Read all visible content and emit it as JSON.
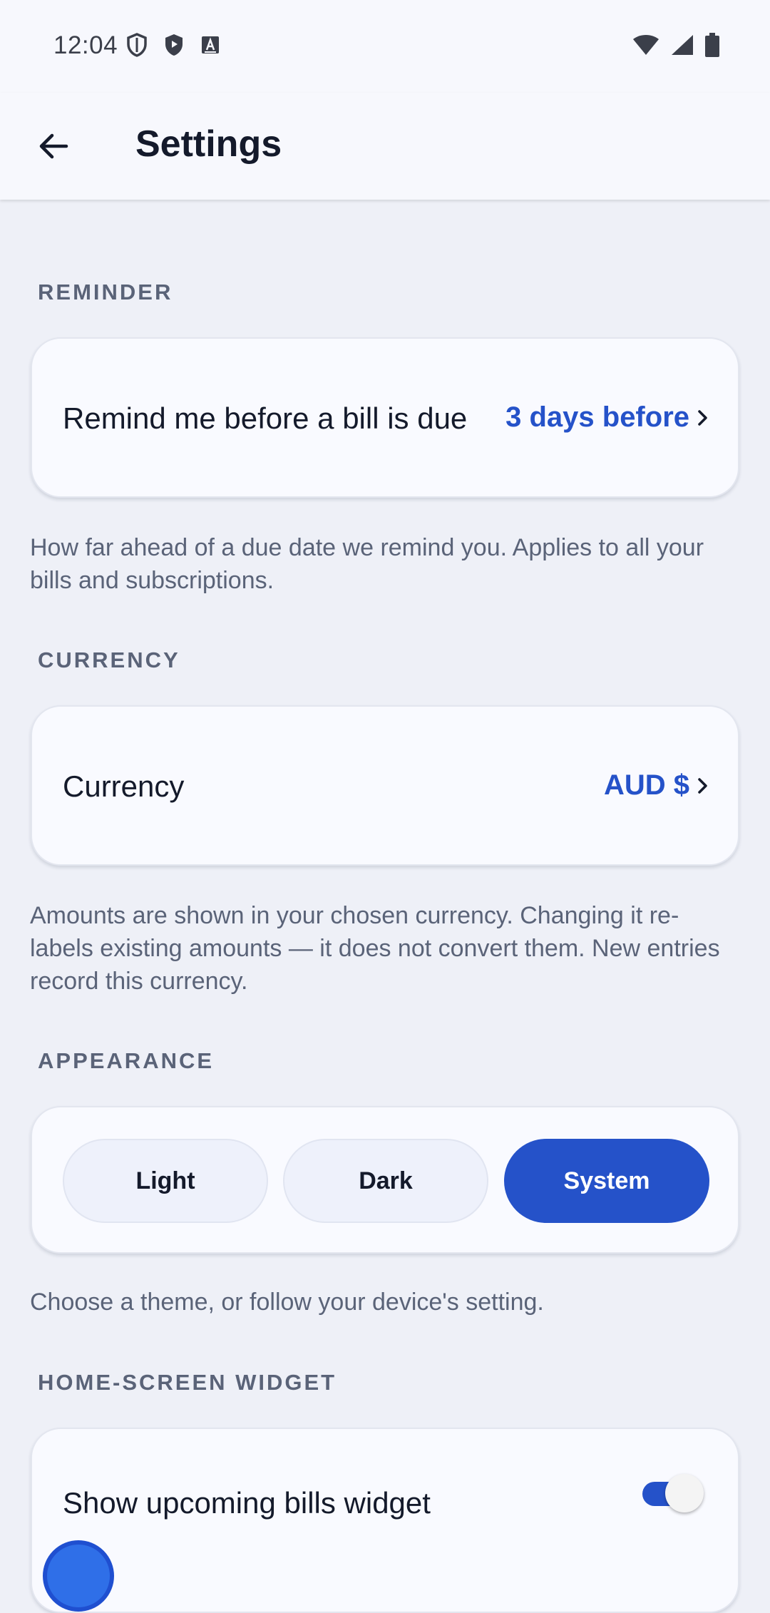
{
  "status_bar": {
    "time": "12:04",
    "left_icons": [
      "shield-outline-icon",
      "play-shield-icon",
      "keyboard-a-icon"
    ],
    "right_icons": [
      "wifi-icon",
      "signal-icon",
      "battery-icon"
    ]
  },
  "app_bar": {
    "title": "Settings",
    "back_icon": "arrow-left-icon"
  },
  "reminder": {
    "section_label": "REMINDER",
    "row_label": "Remind me before a bill is due",
    "row_value": "3 days before",
    "helper": "How far ahead of a due date we remind you. Applies to all your bills and subscriptions."
  },
  "currency": {
    "section_label": "CURRENCY",
    "row_label": "Currency",
    "row_value": "AUD $",
    "helper": "Amounts are shown in your chosen currency. Changing it re-labels existing amounts — it does not convert them. New entries record this currency."
  },
  "appearance": {
    "section_label": "APPEARANCE",
    "options": [
      "Light",
      "Dark",
      "System"
    ],
    "selected": "System",
    "helper": "Choose a theme, or follow your device's setting."
  },
  "widget": {
    "section_label": "HOME-SCREEN WIDGET",
    "row_label": "Show upcoming bills widget",
    "enabled": true
  },
  "colors": {
    "accent": "#2552c9",
    "background": "#eef0f7",
    "card": "#f9faff",
    "muted_text": "#5a6378"
  }
}
